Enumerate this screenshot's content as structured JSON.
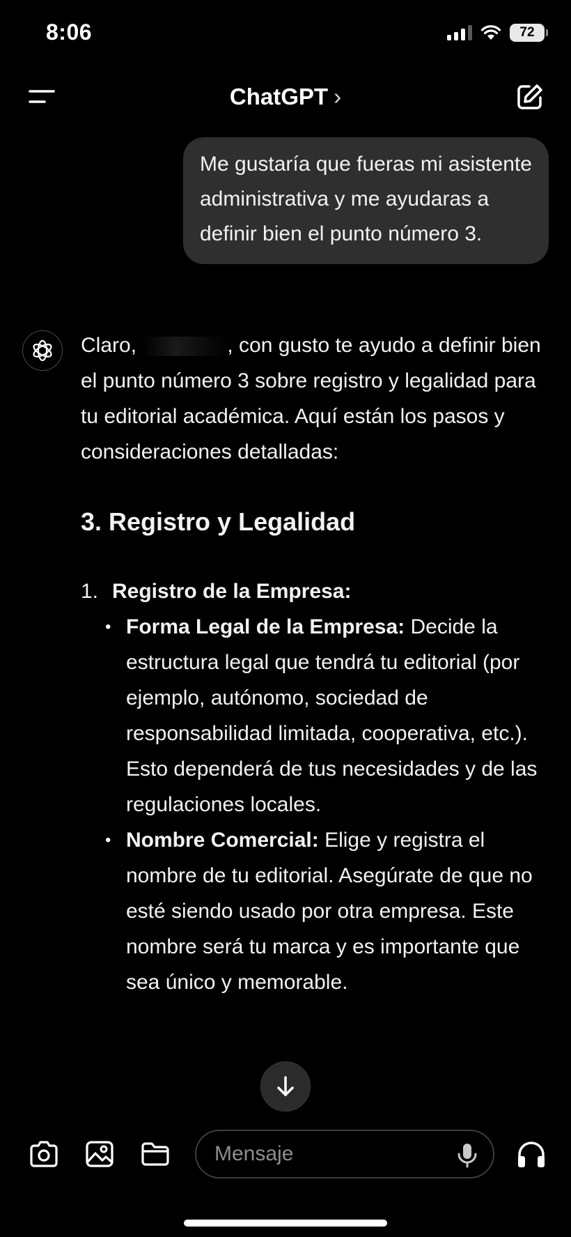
{
  "status_bar": {
    "time": "8:06",
    "battery": "72"
  },
  "nav": {
    "title": "ChatGPT",
    "chevron": "›"
  },
  "user_message": "Me gustaría que fueras mi asistente administrativa y me ayudaras a definir bien el punto número 3.",
  "assistant": {
    "intro_before": "Claro,",
    "intro_after": ", con gusto te ayudo a definir bien el punto número 3 sobre registro y legalidad para tu editorial académica. Aquí están los pasos y consideraciones detalladas:",
    "section_title": "3. Registro y Legalidad",
    "list": [
      {
        "num": "1.",
        "label": "Registro de la Empresa:",
        "bullets": [
          {
            "bold": "Forma Legal de la Empresa:",
            "text": " Decide la estructura legal que tendrá tu editorial (por ejemplo, autónomo, sociedad de responsabilidad limitada, cooperativa, etc.). Esto dependerá de tus necesidades y de las regulaciones locales."
          },
          {
            "bold": "Nombre Comercial:",
            "text": " Elige y registra el nombre de tu editorial. Asegúrate de que no esté siendo usado por otra empresa. Este nombre será tu marca y es importante que sea único y memorable."
          }
        ]
      }
    ]
  },
  "composer": {
    "placeholder": "Mensaje"
  },
  "icons": {
    "menu": "menu-icon",
    "edit": "new-chat-icon",
    "avatar": "openai-logo-icon",
    "camera": "camera-icon",
    "photo": "photo-library-icon",
    "folder": "folder-icon",
    "mic": "microphone-icon",
    "headphones": "voice-mode-icon",
    "scroll": "arrow-down-icon"
  }
}
